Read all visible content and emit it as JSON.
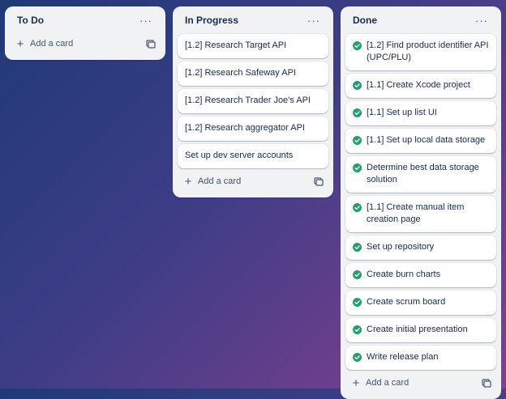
{
  "lists": [
    {
      "title": "To Do",
      "menu_label": "···",
      "cards": [],
      "add_label": "Add a card"
    },
    {
      "title": "In Progress",
      "menu_label": "···",
      "cards": [
        {
          "text": "[1.2] Research Target API"
        },
        {
          "text": "[1.2] Research Safeway API"
        },
        {
          "text": "[1.2] Research Trader Joe's API"
        },
        {
          "text": "[1.2] Research aggregator API"
        },
        {
          "text": "Set up dev server accounts"
        }
      ],
      "add_label": "Add a card"
    },
    {
      "title": "Done",
      "menu_label": "···",
      "cards": [
        {
          "text": "[1.2] Find product identifier API (UPC/PLU)",
          "done": true
        },
        {
          "text": "[1.1] Create Xcode project",
          "done": true
        },
        {
          "text": "[1.1] Set up list UI",
          "done": true
        },
        {
          "text": "[1.1] Set up local data storage",
          "done": true
        },
        {
          "text": "Determine best data storage solution",
          "done": true
        },
        {
          "text": "[1.1] Create manual item creation page",
          "done": true
        },
        {
          "text": "Set up repository",
          "done": true
        },
        {
          "text": "Create burn charts",
          "done": true
        },
        {
          "text": "Create scrum board",
          "done": true
        },
        {
          "text": "Create initial presentation",
          "done": true
        },
        {
          "text": "Write release plan",
          "done": true
        }
      ],
      "add_label": "Add a card"
    }
  ],
  "icons": {
    "add": "plus-icon",
    "template": "card-template-icon",
    "done": "check-circle-icon",
    "menu": "more-horizontal-icon"
  },
  "colors": {
    "done_check": "#22a06b",
    "list_bg": "#f1f2f4",
    "card_bg": "#ffffff"
  }
}
